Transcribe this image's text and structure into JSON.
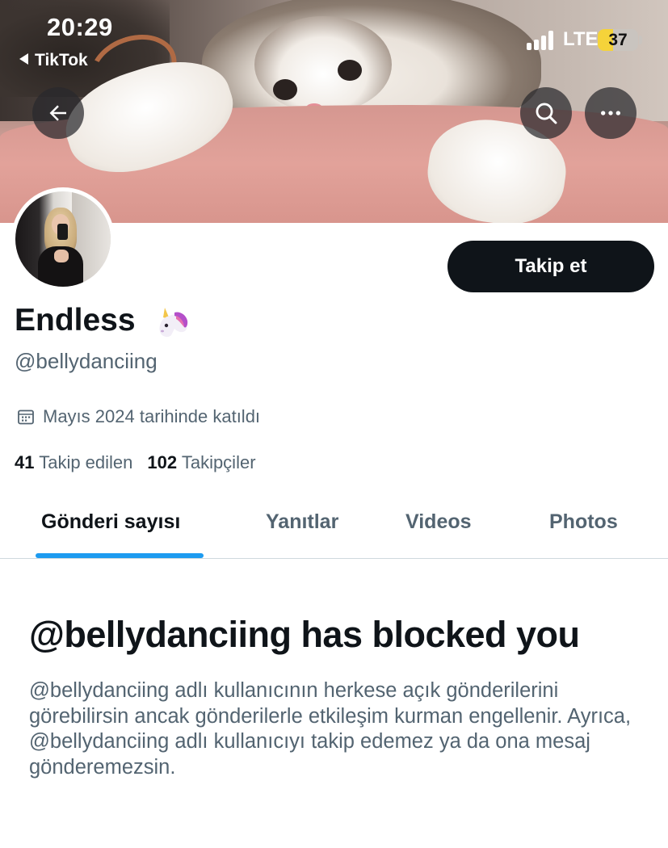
{
  "status_bar": {
    "time": "20:29",
    "back_app": "TikTok",
    "network": "LTE",
    "battery": "37",
    "battery_level": 0.37
  },
  "header": {
    "icons": [
      "back-arrow-icon",
      "search-icon",
      "more-icon"
    ]
  },
  "profile": {
    "display_name": "Endless",
    "emoji": "unicorn",
    "handle": "@bellydanciing",
    "joined": "Mayıs 2024 tarihinde katıldı",
    "following_count": "41",
    "following_label": "Takip edilen",
    "followers_count": "102",
    "followers_label": "Takipçiler",
    "follow_button": "Takip et"
  },
  "tabs": [
    {
      "label": "Gönderi sayısı",
      "active": true
    },
    {
      "label": "Yanıtlar",
      "active": false
    },
    {
      "label": "Videos",
      "active": false
    },
    {
      "label": "Photos",
      "active": false
    }
  ],
  "blocked": {
    "title": "@bellydanciing has blocked you",
    "body": "@bellydanciing adlı kullanıcının herkese açık gönderilerini görebilirsin ancak gönderilerle etkileşim kurman engellenir. Ayrıca, @bellydanciing adlı kullanıcıyı takip edemez ya da ona mesaj gönderemezsin."
  },
  "colors": {
    "primary_text": "#0f1419",
    "secondary_text": "#536471",
    "accent": "#1d9bf0",
    "button_bg": "#0f1419"
  }
}
